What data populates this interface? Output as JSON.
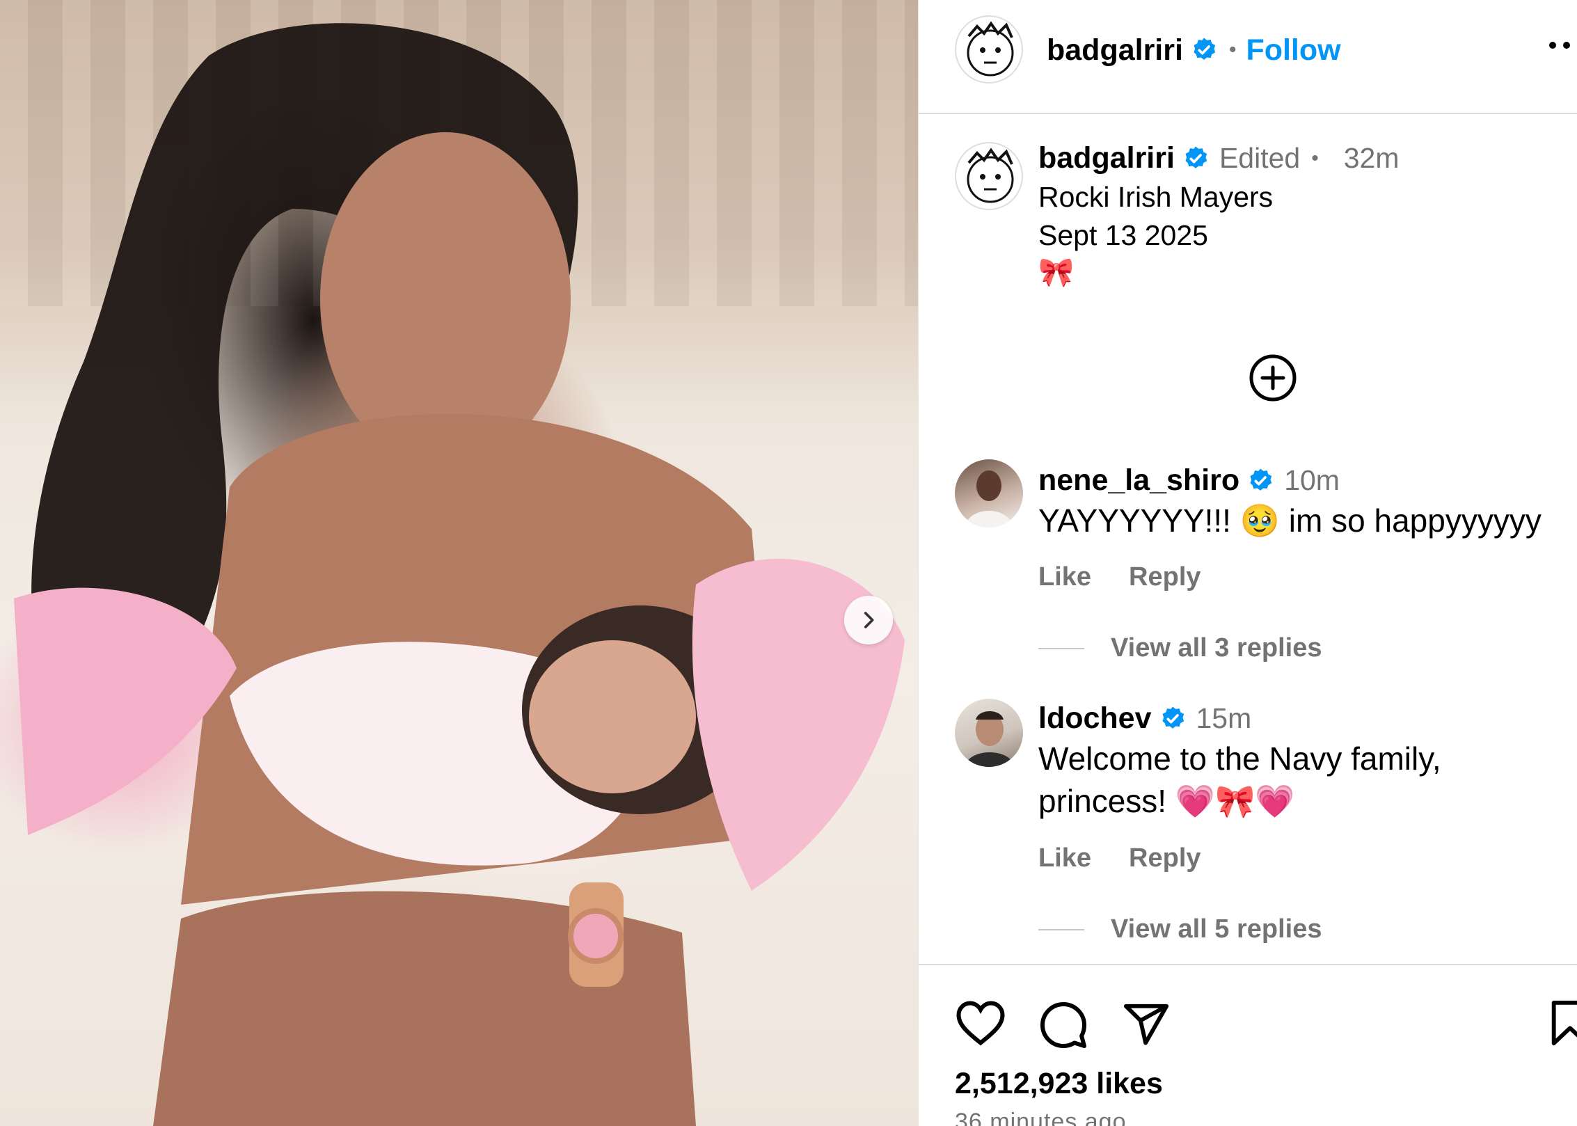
{
  "post": {
    "username": "badgalriri",
    "follow_label": "Follow",
    "separator": "•"
  },
  "caption": {
    "username": "badgalriri",
    "edited_label": "Edited",
    "separator": "•",
    "time": "32m",
    "lines": [
      "Rocki Irish Mayers",
      "Sept 13 2025",
      "🎀"
    ]
  },
  "comments": [
    {
      "username": "nene_la_shiro",
      "time": "10m",
      "text": "YAYYYYYY!!! 🥹 im so happyyyyyy",
      "like_label": "Like",
      "reply_label": "Reply",
      "view_replies": "View all 3 replies"
    },
    {
      "username": "ldochev",
      "time": "15m",
      "text": "Welcome to the Navy family, princess! 💗🎀💗",
      "like_label": "Like",
      "reply_label": "Reply",
      "view_replies": "View all 5 replies"
    }
  ],
  "footer": {
    "likes": "2,512,923 likes",
    "time_ago": "36 minutes ago"
  },
  "icons": {
    "verified_color": "#0095f6",
    "follow_color": "#0095f6"
  }
}
